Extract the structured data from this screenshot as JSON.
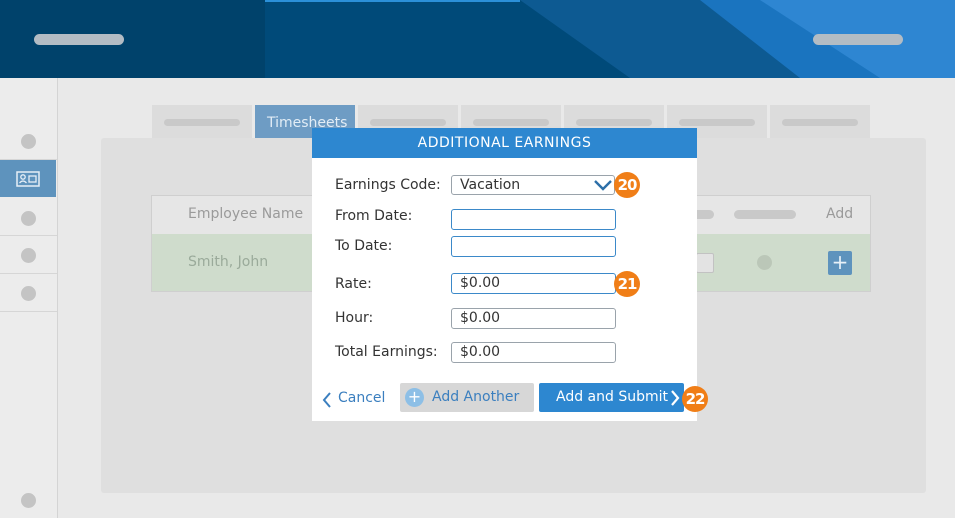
{
  "background": {
    "active_tab_label": "Timesheets",
    "table": {
      "col_name": "Employee Name",
      "col_add": "Add",
      "row_name": "Smith, John",
      "add_symbol": "+"
    }
  },
  "modal": {
    "title": "ADDITIONAL EARNINGS",
    "fields": {
      "earnings_code_label": "Earnings Code:",
      "earnings_code_value": "Vacation",
      "from_date_label": "From Date:",
      "to_date_label": "To Date:",
      "rate_label": "Rate:",
      "rate_value": "$0.00",
      "hour_label": "Hour:",
      "hour_value": "$0.00",
      "total_label": "Total Earnings:",
      "total_value": "$0.00"
    },
    "buttons": {
      "cancel": "Cancel",
      "add_another": "Add Another",
      "add_another_symbol": "+",
      "add_submit": "Add and Submit"
    }
  },
  "callouts": {
    "c20": "20",
    "c21": "21",
    "c22": "22"
  },
  "colors": {
    "header": "#00426b",
    "accent": "#2d87d0",
    "callout": "#f07e17"
  },
  "icons": [
    "id-card-icon",
    "chevron-down-icon",
    "chevron-left-icon",
    "chevron-right-icon",
    "plus-icon"
  ]
}
